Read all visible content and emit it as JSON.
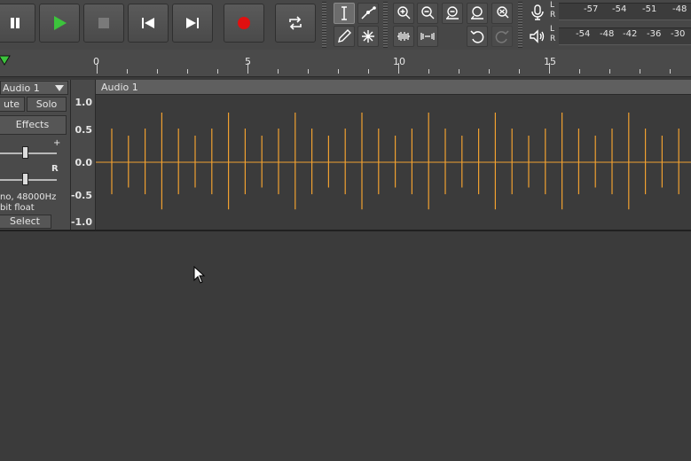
{
  "transport": {
    "buttons": [
      {
        "name": "pause-button",
        "icon": "pause-icon"
      },
      {
        "name": "play-button",
        "icon": "play-icon"
      },
      {
        "name": "stop-button",
        "icon": "stop-icon"
      },
      {
        "name": "skip-to-start-button",
        "icon": "skip-start-icon"
      },
      {
        "name": "skip-to-end-button",
        "icon": "skip-end-icon"
      },
      {
        "name": "record-button",
        "icon": "record-icon"
      },
      {
        "name": "loop-button",
        "icon": "loop-icon"
      }
    ],
    "play_color": "#3cc43c",
    "record_color": "#e01010"
  },
  "tools": {
    "selection": "selection-tool-icon",
    "envelope": "envelope-tool-icon",
    "draw": "draw-tool-icon",
    "multi": "multi-tool-icon"
  },
  "edit_tools": [
    "zoom-in-icon",
    "zoom-out-icon",
    "fit-selection-icon",
    "fit-project-icon",
    "zoom-toggle-icon",
    "trim-icon",
    "silence-icon",
    "undo-icon",
    "redo-icon"
  ],
  "meters": {
    "record": {
      "l": "L",
      "r": "R",
      "labels": [
        "-57",
        "-54",
        "-51",
        "-48"
      ]
    },
    "playback": {
      "l": "L",
      "r": "R",
      "labels": [
        "-54",
        "-48",
        "-42",
        "-36",
        "-30"
      ]
    }
  },
  "ruler": {
    "labels": [
      "0",
      "5",
      "10",
      "15"
    ]
  },
  "track": {
    "name": "Audio 1",
    "mute_label": "ute",
    "solo_label": "Solo",
    "effects_label": "Effects",
    "gain_plus": "+",
    "pan_right": "R",
    "info_line1": "no, 48000Hz",
    "info_line2": "bit float",
    "select_label": "Select",
    "scale": [
      "1.0",
      "0.5",
      "0.0",
      "-0.5",
      "-1.0"
    ],
    "clip_title": "Audio 1",
    "wave_color": "#f0a030"
  }
}
